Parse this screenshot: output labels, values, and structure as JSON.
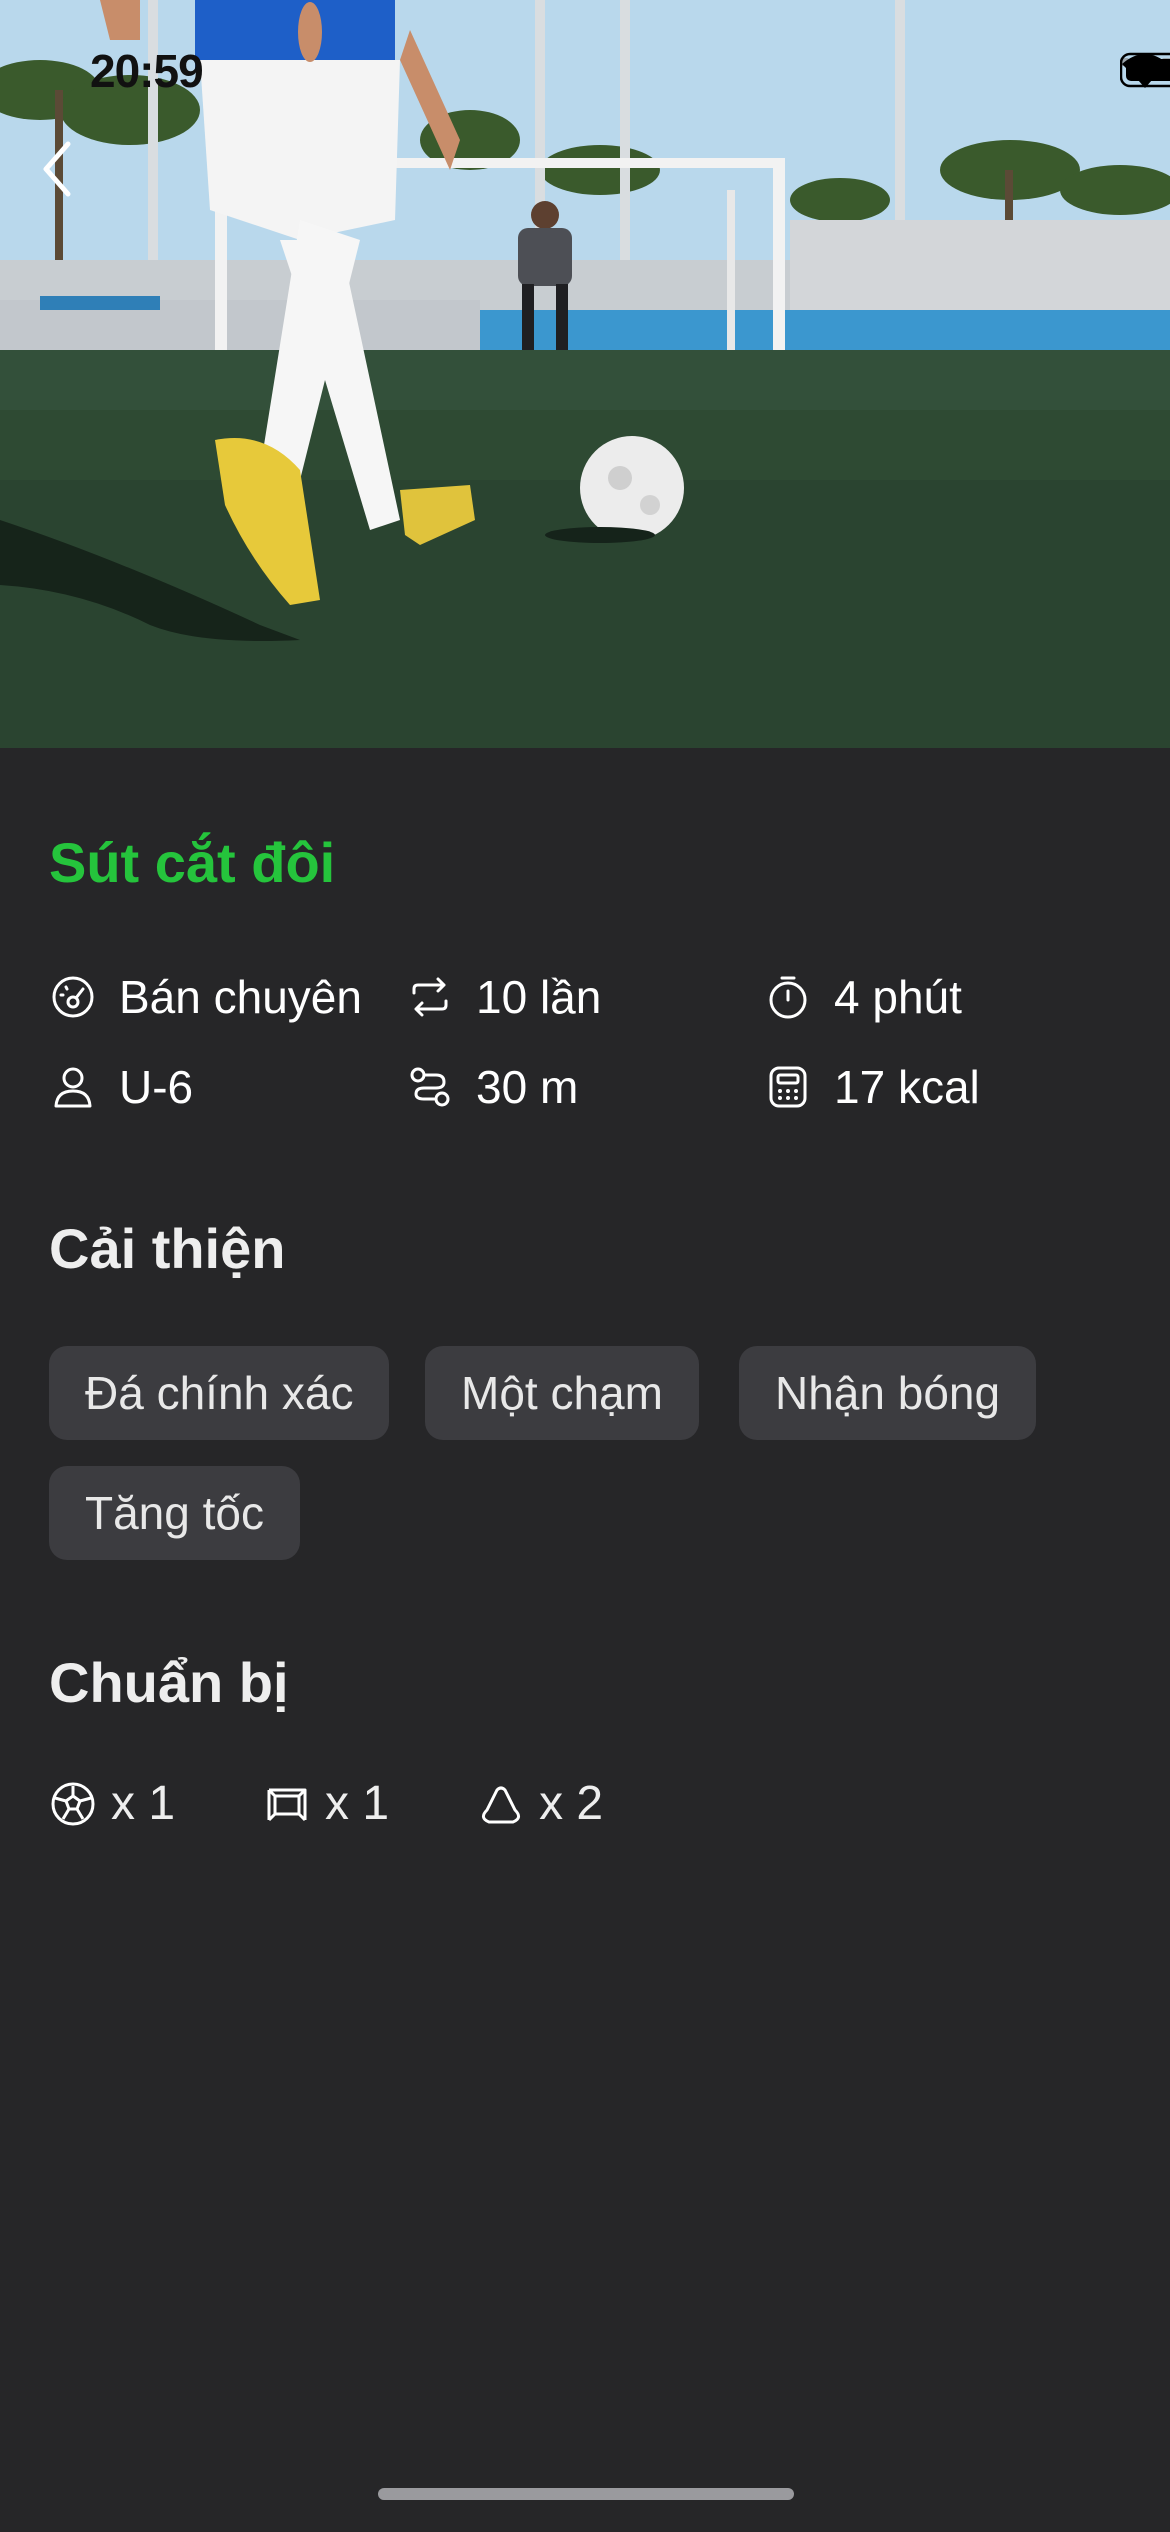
{
  "status_bar": {
    "time": "20:59",
    "icons": [
      "signal-icon",
      "wifi-icon",
      "battery-icon"
    ]
  },
  "hero": {
    "image_description_icon": "football-training-photo",
    "back_icon": "chevron-left-icon"
  },
  "drill": {
    "title": "Sút cắt đôi",
    "title_color": "#25c43c",
    "stats": [
      {
        "icon": "level-gauge-icon",
        "label": "Bán chuyên"
      },
      {
        "icon": "repeat-icon",
        "label": "10 lần"
      },
      {
        "icon": "timer-icon",
        "label": "4 phút"
      },
      {
        "icon": "user-icon",
        "label": "U-6"
      },
      {
        "icon": "route-icon",
        "label": "30 m"
      },
      {
        "icon": "calculator-icon",
        "label": "17 kcal"
      }
    ]
  },
  "improve": {
    "title": "Cải thiện",
    "chips": [
      "Đá chính xác",
      "Một chạm",
      "Nhận bóng",
      "Tăng tốc"
    ]
  },
  "prepare": {
    "title": "Chuẩn bị",
    "items": [
      {
        "icon": "soccer-ball-icon",
        "label": "x 1"
      },
      {
        "icon": "goal-icon",
        "label": "x 1"
      },
      {
        "icon": "cone-icon",
        "label": "x 2"
      }
    ]
  },
  "colors": {
    "background": "#262628",
    "chip_background": "#3c3c40",
    "accent": "#25c43c"
  }
}
